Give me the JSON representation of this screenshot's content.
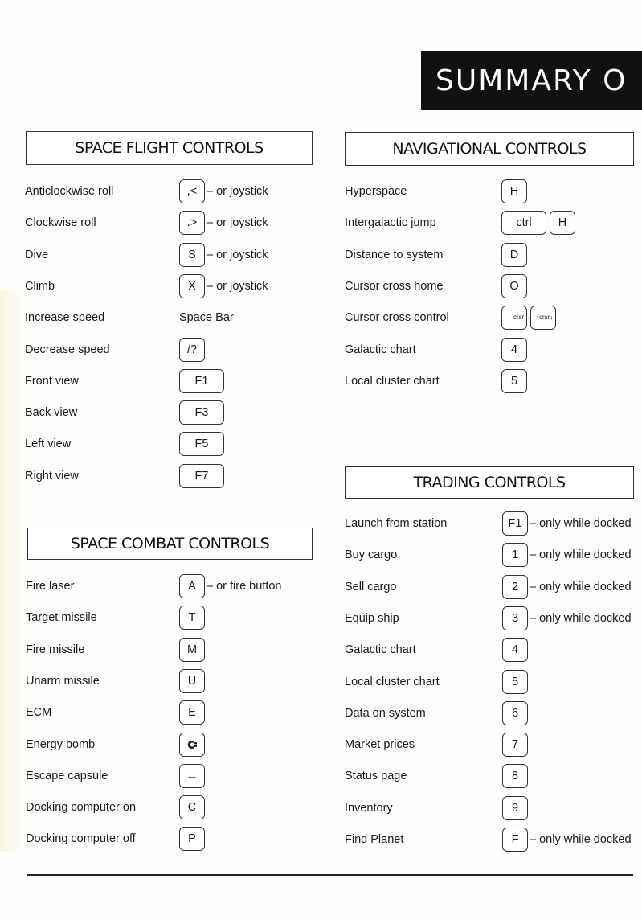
{
  "banner": {
    "title": "SUMMARY O"
  },
  "space_flight": {
    "title": "SPACE FLIGHT CONTROLS",
    "rows": [
      {
        "label": "Anticlockwise roll",
        "keys": [
          ",<"
        ],
        "note": "– or joystick"
      },
      {
        "label": "Clockwise roll",
        "keys": [
          ".>"
        ],
        "note": "– or joystick"
      },
      {
        "label": "Dive",
        "keys": [
          "S"
        ],
        "note": "– or joystick"
      },
      {
        "label": "Climb",
        "keys": [
          "X"
        ],
        "note": "– or joystick"
      },
      {
        "label": "Increase speed",
        "text": "Space Bar"
      },
      {
        "label": "Decrease speed",
        "keys": [
          "/?"
        ]
      },
      {
        "label": "Front view",
        "keys": [
          "F1"
        ]
      },
      {
        "label": "Back view",
        "keys": [
          "F3"
        ]
      },
      {
        "label": "Left view",
        "keys": [
          "F5"
        ]
      },
      {
        "label": "Right view",
        "keys": [
          "F7"
        ]
      }
    ]
  },
  "space_combat": {
    "title": "SPACE COMBAT CONTROLS",
    "rows": [
      {
        "label": "Fire laser",
        "keys": [
          "A"
        ],
        "note": "– or fire button"
      },
      {
        "label": "Target missile",
        "keys": [
          "T"
        ]
      },
      {
        "label": "Fire missile",
        "keys": [
          "M"
        ]
      },
      {
        "label": "Unarm missile",
        "keys": [
          "U"
        ]
      },
      {
        "label": "ECM",
        "keys": [
          "E"
        ]
      },
      {
        "label": "Energy bomb",
        "keys": [
          "commodore-logo-key"
        ]
      },
      {
        "label": "Escape capsule",
        "keys": [
          "←"
        ]
      },
      {
        "label": "Docking computer on",
        "keys": [
          "C"
        ]
      },
      {
        "label": "Docking computer off",
        "keys": [
          "P"
        ]
      }
    ]
  },
  "navigational": {
    "title": "NAVIGATIONAL CONTROLS",
    "rows": [
      {
        "label": "Hyperspace",
        "keys": [
          "H"
        ]
      },
      {
        "label": "Intergalactic jump",
        "keys": [
          "ctrl",
          "H"
        ]
      },
      {
        "label": "Distance to system",
        "keys": [
          "D"
        ]
      },
      {
        "label": "Cursor cross home",
        "keys": [
          "O"
        ]
      },
      {
        "label": "Cursor cross control",
        "keys": [
          "←crsr→",
          "↑crsr↓"
        ]
      },
      {
        "label": "Galactic chart",
        "keys": [
          "4"
        ]
      },
      {
        "label": "Local cluster chart",
        "keys": [
          "5"
        ]
      }
    ]
  },
  "trading": {
    "title": "TRADING CONTROLS",
    "rows": [
      {
        "label": "Launch from station",
        "keys": [
          "F1"
        ],
        "note": "– only while docked"
      },
      {
        "label": "Buy cargo",
        "keys": [
          "1"
        ],
        "note": "– only while docked"
      },
      {
        "label": "Sell cargo",
        "keys": [
          "2"
        ],
        "note": "– only while docked"
      },
      {
        "label": "Equip ship",
        "keys": [
          "3"
        ],
        "note": "– only while docked"
      },
      {
        "label": "Galactic chart",
        "keys": [
          "4"
        ]
      },
      {
        "label": "Local cluster chart",
        "keys": [
          "5"
        ]
      },
      {
        "label": "Data on system",
        "keys": [
          "6"
        ]
      },
      {
        "label": "Market prices",
        "keys": [
          "7"
        ]
      },
      {
        "label": "Status page",
        "keys": [
          "8"
        ]
      },
      {
        "label": "Inventory",
        "keys": [
          "9"
        ]
      },
      {
        "label": "Find Planet",
        "keys": [
          "F"
        ],
        "note": "– only while docked"
      }
    ]
  }
}
